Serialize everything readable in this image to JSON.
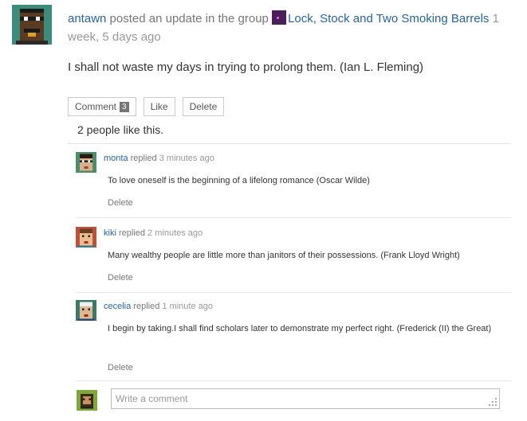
{
  "post": {
    "author": "antawn",
    "action": "posted an update in the group",
    "group": "Lock, Stock and Two Smoking Barrels",
    "time": "1 week, 5 days ago",
    "content": "I shall not waste my days in trying to prolong them. (Ian L. Fleming)"
  },
  "actions": {
    "comment_label": "Comment",
    "comment_count": "3",
    "like_label": "Like",
    "delete_label": "Delete"
  },
  "likes_text": "2 people like this.",
  "replies": [
    {
      "user": "monta",
      "verb": "replied",
      "time": "3 minutes ago",
      "text": "To love oneself is the beginning of a lifelong romance (Oscar Wilde)",
      "delete": "Delete"
    },
    {
      "user": "kiki",
      "verb": "replied",
      "time": "2 minutes ago",
      "text": "Many wealthy people are little more than janitors of their possessions. (Frank Lloyd Wright)",
      "delete": "Delete"
    },
    {
      "user": "cecelia",
      "verb": "replied",
      "time": "1 minute ago",
      "text": "I begin by taking.I shall find scholars later to demonstrate my perfect right. (Frederick (II) the Great)",
      "delete": "Delete"
    }
  ],
  "comment_box": {
    "placeholder": "Write a comment"
  },
  "icons": [
    "avatar-antawn",
    "group-icon",
    "avatar-monta",
    "avatar-kiki",
    "avatar-cecelia",
    "avatar-current-user",
    "resize-grip-icon"
  ]
}
